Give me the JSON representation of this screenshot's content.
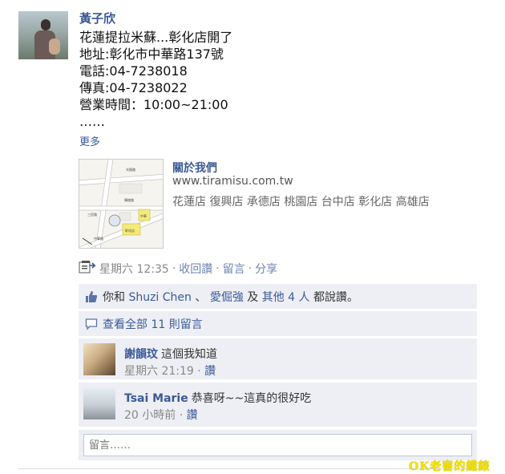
{
  "post": {
    "author": "黃子欣",
    "lines": [
      "花蓮提拉米蘇...彰化店開了",
      "地址:彰化市中華路137號",
      "電話:04-7238018",
      "傳真:04-7238022",
      "營業時間：10:00~21:00",
      "……"
    ],
    "more": "更多"
  },
  "link": {
    "title": "關於我們",
    "url": "www.tiramisu.com.tw",
    "description": "花蓮店 復興店 承德店 桃園店 台中店 彰化店 高雄店",
    "map": {
      "labels": [
        "光復路",
        "陳稜路",
        "三民路",
        "中華路",
        "彰化店",
        "中華"
      ]
    }
  },
  "meta": {
    "time": "星期六 12:35",
    "unlike": "收回讚",
    "comment": "留言",
    "share": "分享",
    "separator": "·"
  },
  "likes": {
    "you": "你和",
    "person1": "Shuzi Chen",
    "sep": "、",
    "person2": "愛倔強",
    "and": "及",
    "others": "其他 4 人",
    "suffix": "都說讚。"
  },
  "view_all": "查看全部 11 則留言",
  "comments": [
    {
      "author": "謝韻玟",
      "text": "這個我知道",
      "time": "星期六 21:19",
      "like": "讚"
    },
    {
      "author": "Tsai Marie",
      "text": "恭喜呀~~這真的很好吃",
      "time": "20 小時前",
      "like": "讚"
    }
  ],
  "write_comment": {
    "placeholder": "留言……"
  },
  "watermark": "OK老害的鐵錶",
  "colors": {
    "link": "#3b5998",
    "ufi_bg": "#edeff4",
    "meta": "#888888"
  }
}
